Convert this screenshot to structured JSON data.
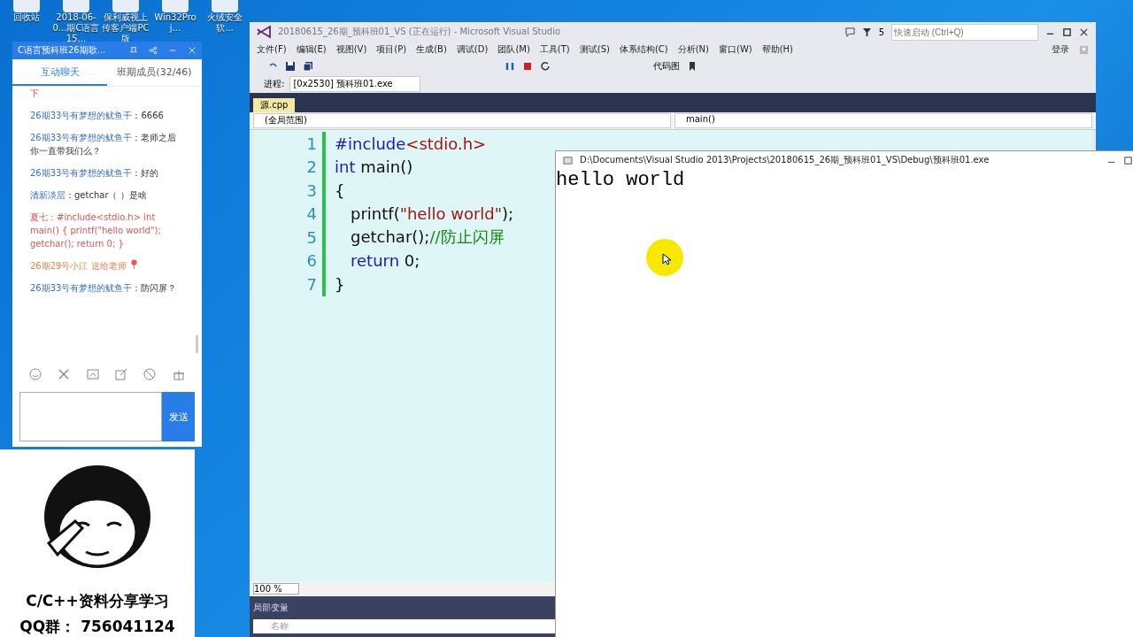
{
  "desktop_icons": [
    {
      "label": "回收站"
    },
    {
      "label": "2018-06-0...期C语言15..."
    },
    {
      "label": "保利威视上传客户端PC版"
    },
    {
      "label": "Win32Proj..."
    },
    {
      "label": "火绒安全软..."
    }
  ],
  "chat_window": {
    "title": "C语言预科班26期歌...",
    "tabs": [
      {
        "label": "互动聊天",
        "selected": true
      },
      {
        "label": "班期成员(32/46)",
        "selected": false
      }
    ],
    "messages": [
      {
        "kind": "teacher",
        "text": "下"
      },
      {
        "kind": "student",
        "sender": "26期33号有梦想的鱿鱼干",
        "text": "：6666"
      },
      {
        "kind": "student",
        "sender": "26期33号有梦想的鱿鱼干",
        "text": "：老师之后你一直带我们么？"
      },
      {
        "kind": "student",
        "sender": "26期33号有梦想的鱿鱼干",
        "text": "：好的"
      },
      {
        "kind": "student",
        "sender": "清新淡层",
        "text": "：getchar（ ）是啥"
      },
      {
        "kind": "teacher",
        "sender": "夏七",
        "text": "：#include<stdio.h> int main() { printf(\"hello world\"); getchar(); return 0; }"
      },
      {
        "kind": "gift",
        "text": "26期29号小江 送给老师"
      },
      {
        "kind": "student",
        "sender": "26期33号有梦想的鱿鱼干",
        "text": "：防闪屏？"
      }
    ],
    "send_button": "发送"
  },
  "promo": {
    "title": "C/C++资料分享学习",
    "qq": "QQ群： 756041124"
  },
  "vs": {
    "title": "20180615_26期_预科班01_VS (正在运行) - Microsoft Visual Studio",
    "notifications": "5",
    "quick_launch": {
      "placeholder": "快速启动 (Ctrl+Q)"
    },
    "menu": [
      "文件(F)",
      "编辑(E)",
      "视图(V)",
      "项目(P)",
      "生成(B)",
      "调试(D)",
      "团队(M)",
      "工具(T)",
      "测试(S)",
      "体系结构(C)",
      "分析(N)",
      "窗口(W)",
      "帮助(H)"
    ],
    "sign_in": "登录",
    "code_map": "代码图",
    "process_label": "进程:",
    "process": "[0x2530] 预科班01.exe",
    "doc_tab": "源.cpp",
    "scope": "(全局范围)",
    "member": "main()",
    "code": [
      {
        "num": "1",
        "indented": false,
        "tokens": [
          {
            "kind": "keyword",
            "text": "#include"
          },
          {
            "kind": "string",
            "text": "<stdio.h>"
          }
        ]
      },
      {
        "num": "2",
        "indented": false,
        "tokens": [
          {
            "kind": "keyword",
            "text": "int"
          },
          {
            "kind": "plain",
            "text": " main()"
          }
        ]
      },
      {
        "num": "3",
        "indented": false,
        "tokens": [
          {
            "kind": "plain",
            "text": "{"
          }
        ]
      },
      {
        "num": "4",
        "indented": true,
        "tokens": [
          {
            "kind": "plain",
            "text": "printf("
          },
          {
            "kind": "string",
            "text": "\"hello world\""
          },
          {
            "kind": "plain",
            "text": ");"
          }
        ]
      },
      {
        "num": "5",
        "indented": true,
        "tokens": [
          {
            "kind": "plain",
            "text": "getchar();"
          },
          {
            "kind": "comment",
            "text": "//防止闪屏"
          }
        ]
      },
      {
        "num": "6",
        "indented": true,
        "tokens": [
          {
            "kind": "keyword",
            "text": "return"
          },
          {
            "kind": "plain",
            "text": " 0;"
          }
        ]
      },
      {
        "num": "7",
        "indented": false,
        "tokens": [
          {
            "kind": "plain",
            "text": "}"
          }
        ]
      }
    ],
    "zoom": "100 %",
    "locals_title": "局部变量",
    "locals_column": "名称"
  },
  "console": {
    "title": "D:\\Documents\\Visual Studio 2013\\Projects\\20180615_26期_预科班01_VS\\Debug\\预科班01.exe",
    "output": "hello world"
  }
}
